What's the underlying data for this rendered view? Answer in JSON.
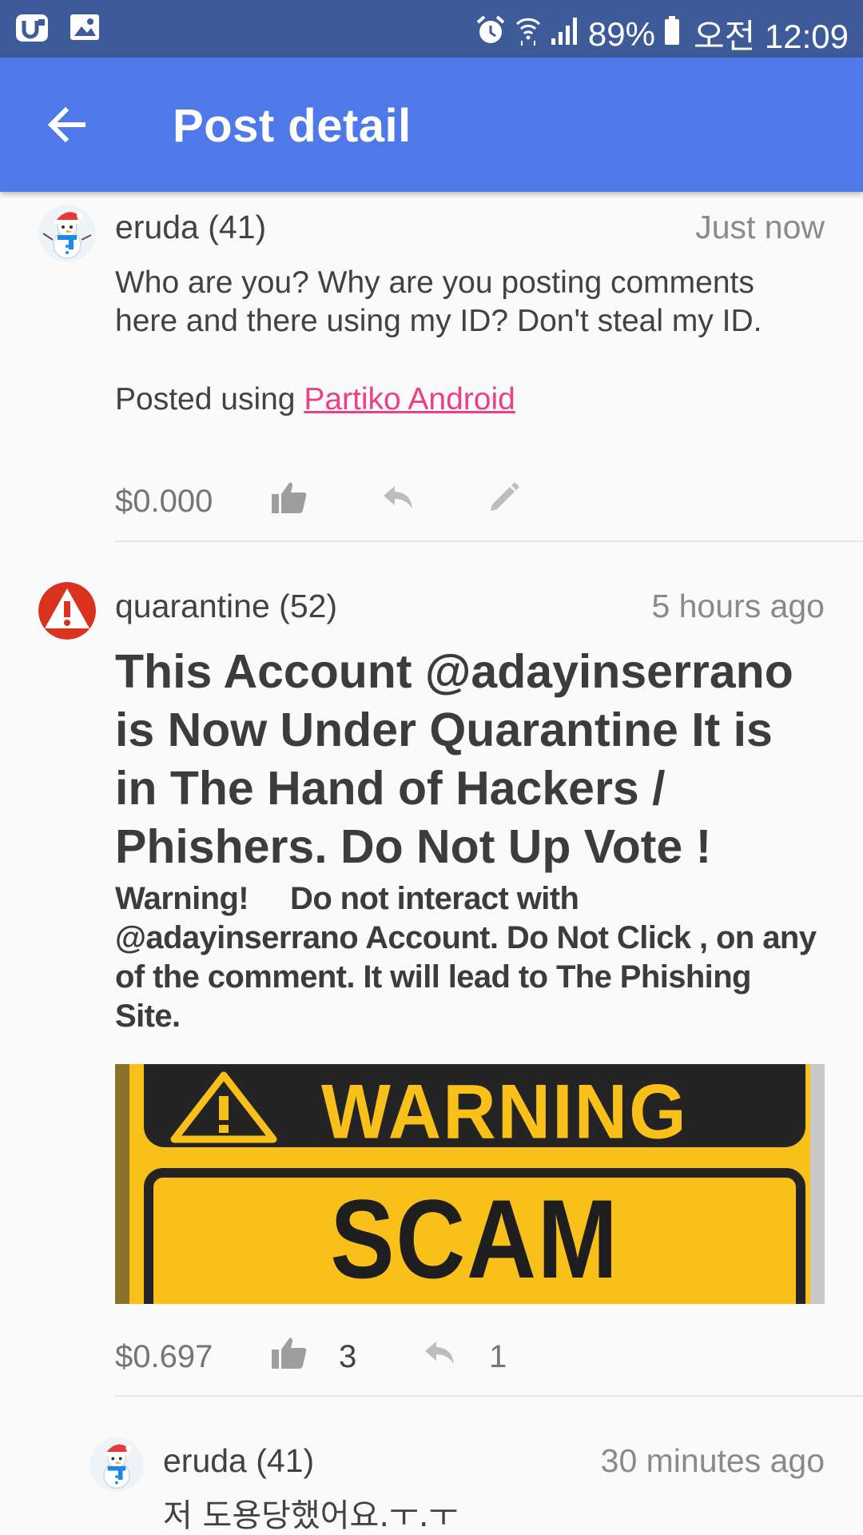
{
  "status_bar": {
    "battery_percent": "89%",
    "time": "오전 12:09",
    "icons": [
      "app-icon",
      "gallery-icon",
      "alarm-icon",
      "wifi-icon",
      "signal-icon",
      "battery-icon"
    ]
  },
  "app_bar": {
    "title": "Post detail",
    "back_icon": "arrow-back-icon"
  },
  "comments": [
    {
      "author": "eruda (41)",
      "time": "Just now",
      "body_line1": "Who are you? Why are you posting comments",
      "body_line2": "here and there using my ID? Don't steal my ID.",
      "posted_using_prefix": "Posted using ",
      "posted_using_link": "Partiko Android",
      "payout": "$0.000"
    },
    {
      "author": "quarantine (52)",
      "time": "5 hours ago",
      "headline_lines": [
        "This Account @adayinserrano",
        "is Now Under Quarantine It is",
        "in The Hand of Hackers /",
        "Phishers. Do Not Up Vote !"
      ],
      "warning_label": "Warning!",
      "warning_rest": "Do not interact with",
      "warning_lines": [
        "@adayinserrano Account. Do Not Click , on any",
        "of the comment. It will lead to The Phishing",
        "Site."
      ],
      "image_text_top": "WARNING",
      "image_text_bottom": "SCAM ALERT!",
      "payout": "$0.697",
      "votes": "3",
      "replies": "1"
    },
    {
      "author": "eruda (41)",
      "time": "30 minutes ago",
      "body": "저 도용당했어요.ㅜ.ㅜ"
    }
  ],
  "colors": {
    "status_bar": "#3d5a99",
    "app_bar": "#4f78e8",
    "link": "#ec3f86",
    "warning_yellow": "#f9c01a"
  }
}
